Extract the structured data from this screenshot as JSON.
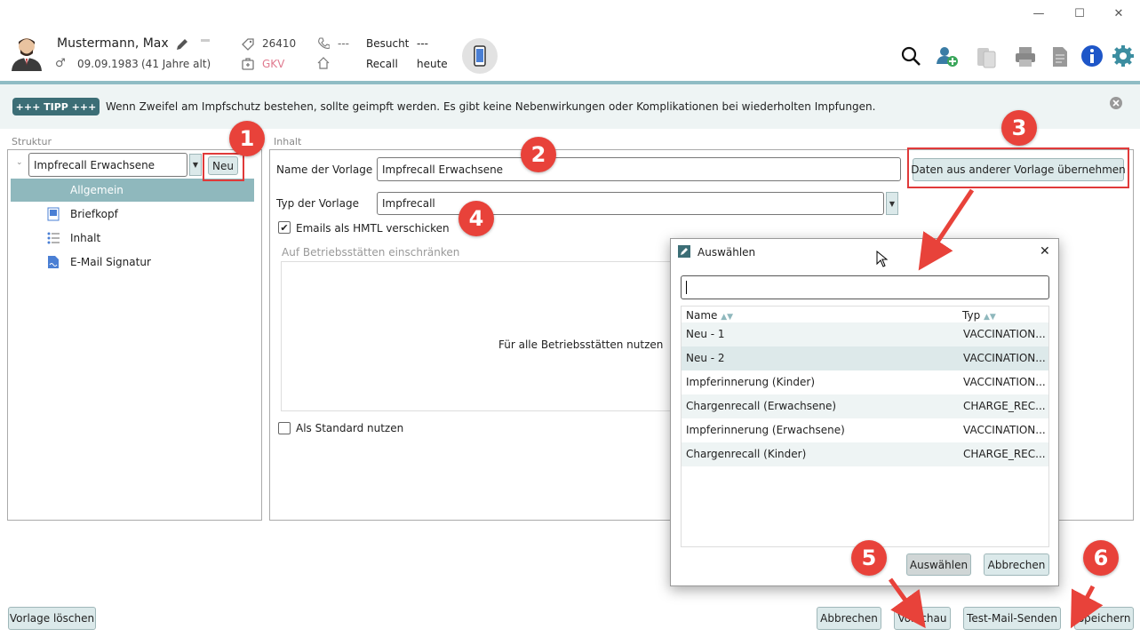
{
  "window": {
    "minimize": "—",
    "maximize": "☐",
    "close": "✕"
  },
  "patient": {
    "name": "Mustermann, Max",
    "birthdate": "09.09.1983",
    "age": "(41 Jahre alt)",
    "id": "26410",
    "insurance": "GKV",
    "phone": "---",
    "visited_label": "Besucht",
    "visited_value": "---",
    "recall_label": "Recall",
    "recall_value": "heute"
  },
  "tip": {
    "badge": "+++ TIPP +++",
    "text": "Wenn Zweifel am Impfschutz bestehen, sollte geimpft werden. Es gibt keine Nebenwirkungen oder Komplikationen bei wiederholten Impfungen."
  },
  "structure": {
    "title": "Struktur",
    "template_select": "Impfrecall Erwachsene",
    "new_button": "Neu",
    "items": [
      "Allgemein",
      "Briefkopf",
      "Inhalt",
      "E-Mail Signatur"
    ]
  },
  "content": {
    "title": "Inhalt",
    "name_label": "Name der Vorlage",
    "name_value": "Impfrecall Erwachsene",
    "type_label": "Typ der Vorlage",
    "type_value": "Impfrecall",
    "html_checkbox_label": "Emails als HMTL verschicken",
    "html_checked": true,
    "restrict_label": "Auf Betriebsstätten einschränken",
    "all_sites": "Für alle Betriebsstätten nutzen",
    "default_label": "Als Standard nutzen",
    "default_checked": false,
    "copy_button": "Daten aus anderer Vorlage übernehmen"
  },
  "dialog": {
    "title": "Auswählen",
    "search_value": "",
    "col_name": "Name",
    "col_type": "Typ",
    "rows": [
      {
        "name": "Neu - 1",
        "type": "VACCINATION..."
      },
      {
        "name": "Neu - 2",
        "type": "VACCINATION..."
      },
      {
        "name": "Impferinnerung (Kinder)",
        "type": "VACCINATION..."
      },
      {
        "name": "Chargenrecall (Erwachsene)",
        "type": "CHARGE_REC..."
      },
      {
        "name": "Impferinnerung (Erwachsene)",
        "type": "VACCINATION..."
      },
      {
        "name": "Chargenrecall (Kinder)",
        "type": "CHARGE_REC..."
      }
    ],
    "select_button": "Auswählen",
    "cancel_button": "Abbrechen"
  },
  "footer": {
    "delete_button": "Vorlage löschen",
    "cancel_button": "Abbrechen",
    "preview_button": "Vorschau",
    "test_mail_button": "Test-Mail-Senden",
    "save_button": "Speichern"
  },
  "annotations": [
    "1",
    "2",
    "3",
    "4",
    "5",
    "6"
  ],
  "colors": {
    "accent": "#3c6e76",
    "annotation": "#e8423a",
    "button": "#dbe9ea",
    "selection": "#8fb8bd",
    "insurance": "#e07a8f"
  }
}
